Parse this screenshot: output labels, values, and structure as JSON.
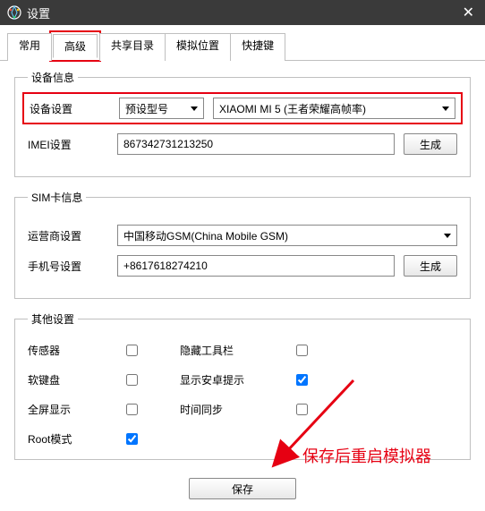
{
  "window": {
    "title": "设置"
  },
  "tabs": {
    "common": "常用",
    "advanced": "高级",
    "shared": "共享目录",
    "location": "模拟位置",
    "hotkey": "快捷键"
  },
  "device_info": {
    "legend": "设备信息",
    "device_setting_label": "设备设置",
    "preset_label": "预设型号",
    "model_value": "XIAOMI MI 5 (王者荣耀高帧率)",
    "imei_label": "IMEI设置",
    "imei_value": "867342731213250",
    "generate": "生成"
  },
  "sim_info": {
    "legend": "SIM卡信息",
    "carrier_label": "运营商设置",
    "carrier_value": "中国移动GSM(China Mobile GSM)",
    "phone_label": "手机号设置",
    "phone_value": "+8617618274210",
    "generate": "生成"
  },
  "other": {
    "legend": "其他设置",
    "sensor": "传感器",
    "hide_toolbar": "隐藏工具栏",
    "soft_keyboard": "软键盘",
    "show_android_tip": "显示安卓提示",
    "fullscreen": "全屏显示",
    "time_sync": "时间同步",
    "root_mode": "Root模式"
  },
  "save": "保存",
  "annotation": "保存后重启模拟器"
}
